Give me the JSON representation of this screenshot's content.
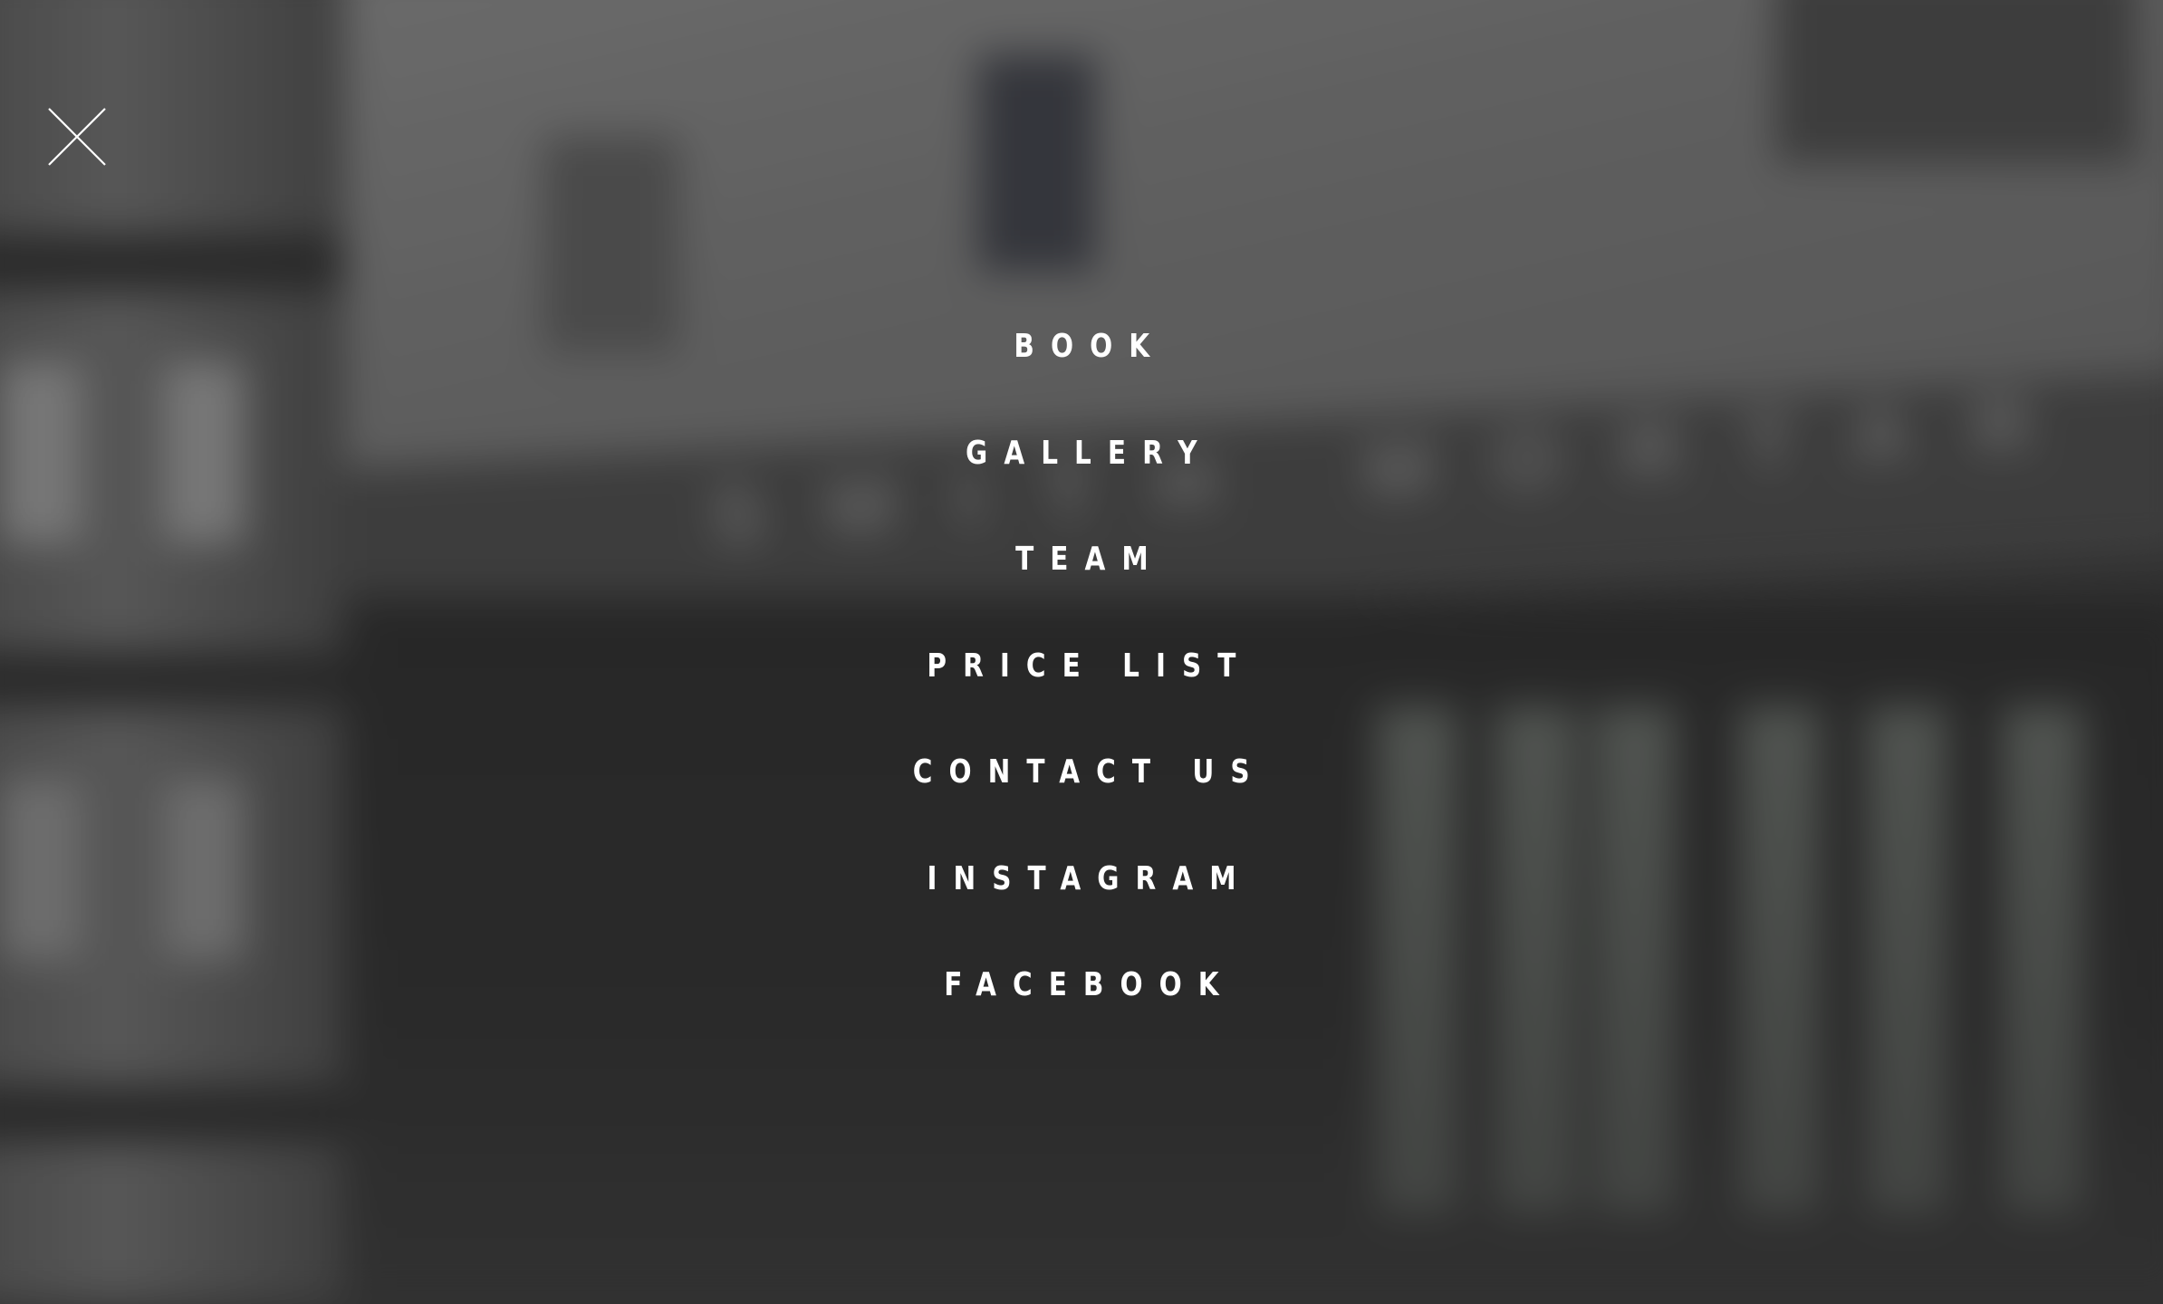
{
  "close_button": {
    "icon": "close-icon",
    "color": "#ffffff"
  },
  "menu": {
    "items": [
      {
        "label": "BOOK"
      },
      {
        "label": "GALLERY"
      },
      {
        "label": "TEAM"
      },
      {
        "label": "PRICE LIST"
      },
      {
        "label": "CONTACT US"
      },
      {
        "label": "INSTAGRAM"
      },
      {
        "label": "FACEBOOK"
      }
    ],
    "text_color": "#ffffff"
  }
}
